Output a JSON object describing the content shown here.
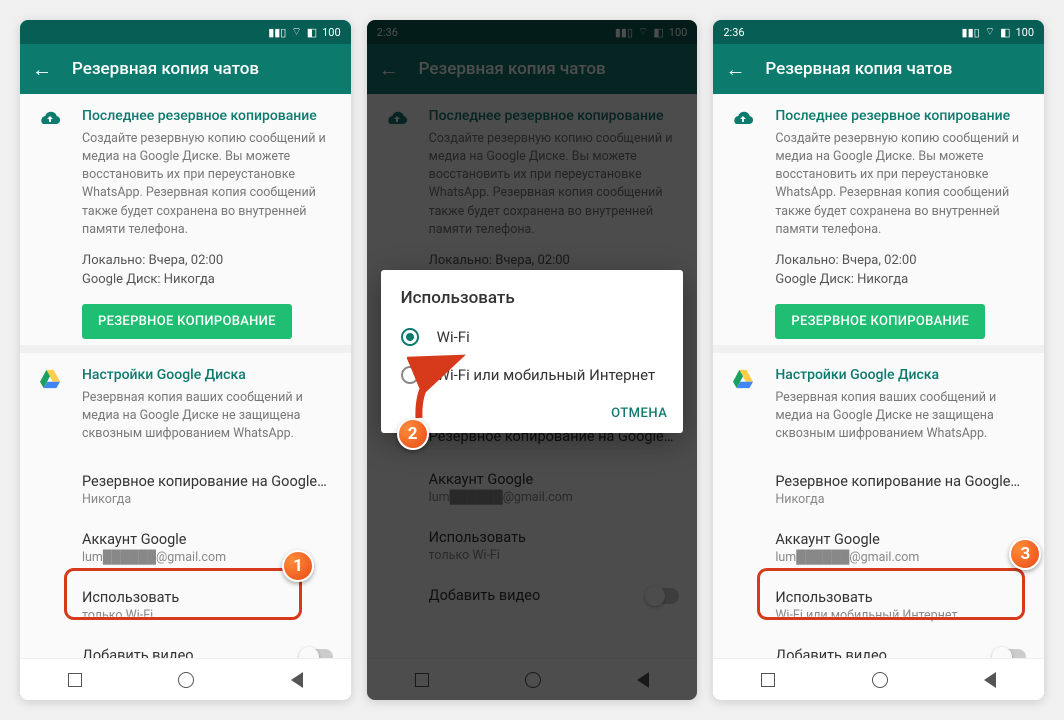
{
  "status": {
    "time": "2:36",
    "icons": "..ıl ⦿ 100"
  },
  "appbar": {
    "title": "Резервная копия чатов"
  },
  "backup": {
    "section_title": "Последнее резервное копирование",
    "desc": "Создайте резервную копию сообщений и медиа на Google Диске. Вы можете восстановить их при переустановке WhatsApp. Резервная копия сообщений также будет сохранена во внутренней памяти телефона.",
    "local_label": "Локально: Вчера, 02:00",
    "gdrive_label": "Google Диск: Никогда",
    "button": "РЕЗЕРВНОЕ КОПИРОВАНИЕ"
  },
  "gdrive": {
    "section_title": "Настройки Google Диска",
    "desc": "Резервная копия ваших сообщений и медиа на Google Диске не защищена сквозным шифрованием WhatsApp.",
    "freq_title": "Резервное копирование на Google…",
    "freq_sub": "Никогда",
    "account_title": "Аккаунт Google",
    "account_sub_masked": "lum██████@gmail.com",
    "use_title": "Использовать",
    "use_sub_wifi": "только Wi-Fi",
    "use_sub_both": "Wi-Fi или мобильный Интернет",
    "video_title": "Добавить видео"
  },
  "dialog": {
    "title": "Использовать",
    "opt_wifi": "Wi-Fi",
    "opt_both": "Wi-Fi или мобильный Интернет",
    "cancel": "ОТМЕНА"
  },
  "badges": {
    "b1": "1",
    "b2": "2",
    "b3": "3"
  }
}
